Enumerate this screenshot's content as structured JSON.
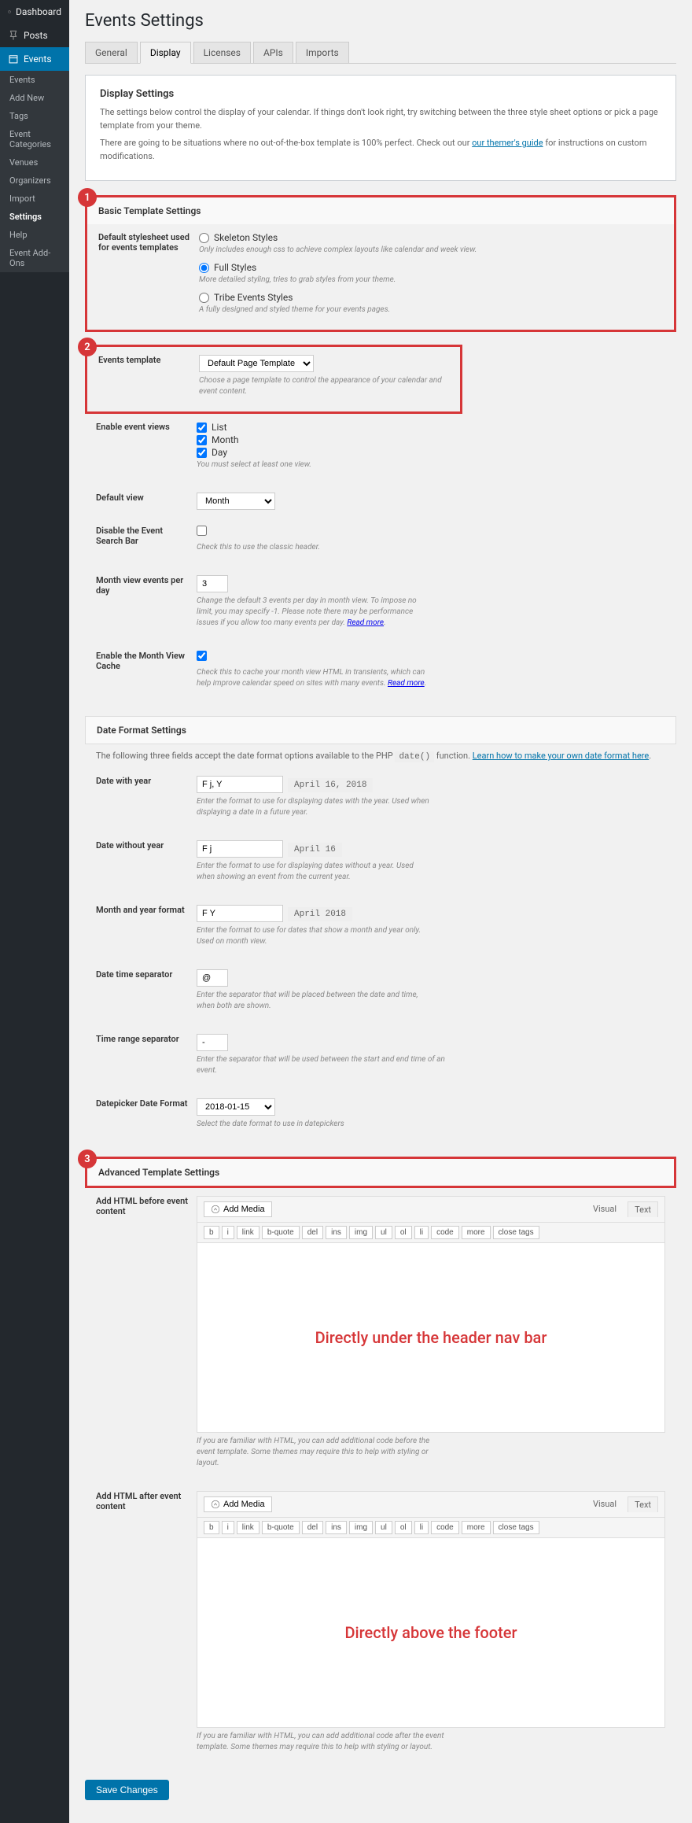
{
  "sidebar": {
    "items": [
      {
        "label": "Dashboard",
        "icon": "dashboard"
      },
      {
        "label": "Posts",
        "icon": "pin"
      },
      {
        "label": "Events",
        "icon": "calendar",
        "active": true
      }
    ],
    "sub": [
      "Events",
      "Add New",
      "Tags",
      "Event Categories",
      "Venues",
      "Organizers",
      "Import",
      "Settings",
      "Help",
      "Event Add-Ons"
    ],
    "sub_current": "Settings"
  },
  "page_title": "Events Settings",
  "tabs": [
    "General",
    "Display",
    "Licenses",
    "APIs",
    "Imports"
  ],
  "tab_active": "Display",
  "display_settings": {
    "heading": "Display Settings",
    "p1": "The settings below control the display of your calendar. If things don't look right, try switching between the three style sheet options or pick a page template from your theme.",
    "p2_a": "There are going to be situations where no out-of-the-box template is 100% perfect. Check out our ",
    "p2_link": "our themer's guide",
    "p2_b": " for instructions on custom modifications."
  },
  "basic": {
    "badge": "1",
    "heading": "Basic Template Settings",
    "stylesheet_label": "Default stylesheet used for events templates",
    "opt1": "Skeleton Styles",
    "opt1_hint": "Only includes enough css to achieve complex layouts like calendar and week view.",
    "opt2": "Full Styles",
    "opt2_hint": "More detailed styling, tries to grab styles from your theme.",
    "opt3": "Tribe Events Styles",
    "opt3_hint": "A fully designed and styled theme for your events pages."
  },
  "events_template": {
    "badge": "2",
    "label": "Events template",
    "value": "Default Page Template",
    "hint": "Choose a page template to control the appearance of your calendar and event content."
  },
  "views": {
    "label": "Enable event views",
    "opts": [
      "List",
      "Month",
      "Day"
    ],
    "hint": "You must select at least one view."
  },
  "default_view": {
    "label": "Default view",
    "value": "Month"
  },
  "disable_search": {
    "label": "Disable the Event Search Bar",
    "hint": "Check this to use the classic header."
  },
  "month_events": {
    "label": "Month view events per day",
    "value": "3",
    "hint": "Change the default 3 events per day in month view. To impose no limit, you may specify -1. Please note there may be performance issues if you allow too many events per day. ",
    "link": "Read more"
  },
  "month_cache": {
    "label": "Enable the Month View Cache",
    "checked": true,
    "hint": "Check this to cache your month view HTML in transients, which can help improve calendar speed on sites with many events. ",
    "link": "Read more"
  },
  "date_format": {
    "heading": "Date Format Settings",
    "intro_a": "The following three fields accept the date format options available to the PHP ",
    "intro_code": "date()",
    "intro_b": " function. ",
    "intro_link": "Learn how to make your own date format here",
    "rows": [
      {
        "label": "Date with year",
        "value": "F j, Y",
        "sample": "April 16, 2018",
        "hint": "Enter the format to use for displaying dates with the year. Used when displaying a date in a future year."
      },
      {
        "label": "Date without year",
        "value": "F j",
        "sample": "April 16",
        "hint": "Enter the format to use for displaying dates without a year. Used when showing an event from the current year."
      },
      {
        "label": "Month and year format",
        "value": "F Y",
        "sample": "April 2018",
        "hint": "Enter the format to use for dates that show a month and year only. Used on month view."
      },
      {
        "label": "Date time separator",
        "value": "@",
        "sample": "",
        "hint": "Enter the separator that will be placed between the date and time, when both are shown."
      },
      {
        "label": "Time range separator",
        "value": "-",
        "sample": "",
        "hint": "Enter the separator that will be used between the start and end time of an event."
      }
    ],
    "datepicker": {
      "label": "Datepicker Date Format",
      "value": "2018-01-15",
      "hint": "Select the date format to use in datepickers"
    }
  },
  "advanced": {
    "badge": "3",
    "heading": "Advanced Template Settings",
    "before": {
      "label": "Add HTML before event content",
      "placeholder": "Directly under the header nav bar",
      "hint": "If you are familiar with HTML, you can add additional code before the event template. Some themes may require this to help with styling or layout."
    },
    "after": {
      "label": "Add HTML after event content",
      "placeholder": "Directly above the footer",
      "hint": "If you are familiar with HTML, you can add additional code after the event template. Some themes may require this to help with styling or layout."
    },
    "media_btn": "Add Media",
    "ed_tabs": [
      "Visual",
      "Text"
    ],
    "qt": [
      "b",
      "i",
      "link",
      "b-quote",
      "del",
      "ins",
      "img",
      "ul",
      "ol",
      "li",
      "code",
      "more",
      "close tags"
    ]
  },
  "save": "Save Changes"
}
